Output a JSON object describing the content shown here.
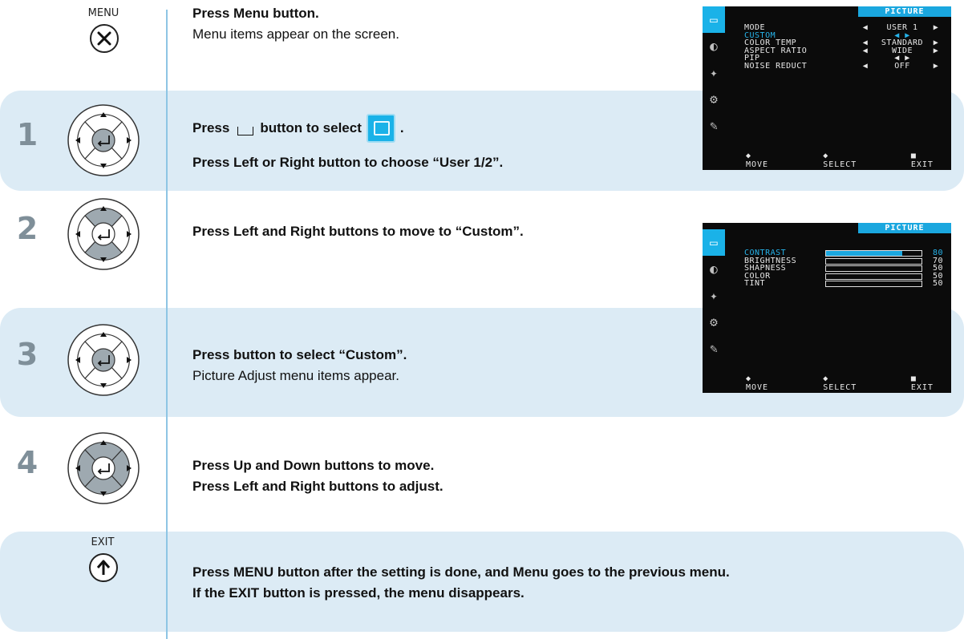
{
  "menu_button": {
    "label": "MENU"
  },
  "exit_button": {
    "label": "EXIT"
  },
  "steps": {
    "menu": {
      "line1": "Press Menu button.",
      "line2": "Menu items appear on the screen."
    },
    "s1": {
      "num": "1",
      "line1a": "Press",
      "line1b": "button to select",
      "line1c": ".",
      "line2": "Press Left or Right button to choose “User 1/2”."
    },
    "s2": {
      "num": "2",
      "line1": "Press Left and Right buttons to move to  “Custom”."
    },
    "s3": {
      "num": "3",
      "line1": "Press button to select  “Custom”.",
      "line2": "Picture Adjust menu items appear."
    },
    "s4": {
      "num": "4",
      "line1": "Press Up and Down buttons to move.",
      "line2": "Press Left and Right buttons to adjust."
    },
    "exit": {
      "line1": "Press MENU button after the setting is done, and Menu goes to the previous menu.",
      "line2": "If the EXIT button is pressed, the menu disappears."
    }
  },
  "osd1": {
    "title": "PICTURE",
    "rows": [
      {
        "key": "MODE",
        "left": "◀",
        "value": "USER 1",
        "right": "▶",
        "highlight": false
      },
      {
        "key": "CUSTOM",
        "left": "",
        "value": "◀ ▶",
        "right": "",
        "highlight": true
      },
      {
        "key": "COLOR TEMP",
        "left": "◀",
        "value": "STANDARD",
        "right": "▶",
        "highlight": false
      },
      {
        "key": "ASPECT RATIO",
        "left": "◀",
        "value": "WIDE",
        "right": "▶",
        "highlight": false
      },
      {
        "key": "PIP",
        "left": "",
        "value": "◀ ▶",
        "right": "",
        "highlight": false
      },
      {
        "key": "NOISE REDUCT",
        "left": "◀",
        "value": "OFF",
        "right": "▶",
        "highlight": false
      }
    ],
    "footer": {
      "move": "◆ MOVE",
      "select": "◆ SELECT",
      "exit": "■ EXIT"
    }
  },
  "osd2": {
    "title": "PICTURE",
    "rows": [
      {
        "key": "CONTRAST",
        "value": "80",
        "level": 0.8,
        "highlight": true
      },
      {
        "key": "BRIGHTNESS",
        "value": "70",
        "level": 0.7,
        "highlight": false
      },
      {
        "key": "SHAPNESS",
        "value": "50",
        "level": 0.5,
        "highlight": false
      },
      {
        "key": "COLOR",
        "value": "50",
        "level": 0.5,
        "highlight": false
      },
      {
        "key": "TINT",
        "value": "50",
        "level": 0.5,
        "highlight": false
      }
    ],
    "footer": {
      "move": "◆ MOVE",
      "select": "◆ SELECT",
      "exit": "■ EXIT"
    }
  },
  "colors": {
    "band": "#dcebf5",
    "accent": "#1aa7df",
    "divider": "#8ec5e4"
  },
  "icons": [
    "close-x-icon",
    "dpad-icon",
    "enter-icon",
    "up-arrow-icon",
    "tv-icon",
    "palette-icon",
    "satellite-icon",
    "wrench-icon",
    "tools-icon"
  ]
}
